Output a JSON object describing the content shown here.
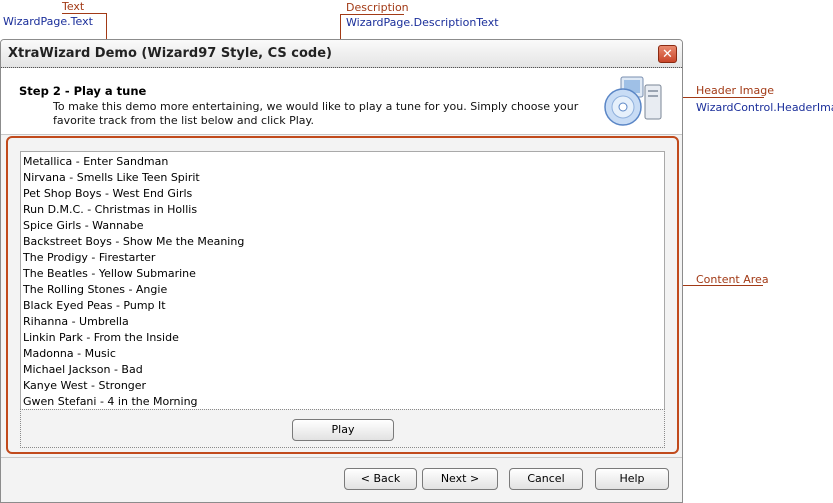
{
  "callouts": {
    "text": {
      "title": "Text",
      "prop": "WizardPage.Text"
    },
    "description": {
      "title": "Description",
      "prop": "WizardPage.DescriptionText"
    },
    "header_image": {
      "title": "Header Image",
      "prop": "WizardControl.HeaderImage"
    },
    "content_area": {
      "title": "Content Area"
    }
  },
  "window": {
    "title": "XtraWizard Demo (Wizard97  Style, CS code)",
    "close_glyph": "✕"
  },
  "page": {
    "step_title": "Step 2 - Play a tune",
    "description": "To make this demo more entertaining, we would like to play a tune for you. Simply choose your favorite track from the list below and click Play."
  },
  "tracks": [
    "Metallica - Enter Sandman",
    "Nirvana - Smells Like Teen Spirit",
    "Pet Shop Boys - West End Girls",
    "Run D.M.C. - Christmas in Hollis",
    "Spice Girls - Wannabe",
    "Backstreet Boys - Show Me the Meaning",
    "The Prodigy - Firestarter",
    "The Beatles - Yellow Submarine",
    "The Rolling Stones - Angie",
    "Black Eyed Peas - Pump It",
    "Rihanna - Umbrella",
    "Linkin Park - From the Inside",
    "Madonna - Music",
    "Michael Jackson - Bad",
    "Kanye West - Stronger",
    "Gwen Stefani - 4 in the Morning"
  ],
  "buttons": {
    "play": "Play",
    "back": "< Back",
    "next": "Next >",
    "cancel": "Cancel",
    "help": "Help"
  },
  "colors": {
    "accent": "#c14a1c",
    "callout_title": "#a23a16",
    "callout_prop": "#1a2e9a"
  }
}
